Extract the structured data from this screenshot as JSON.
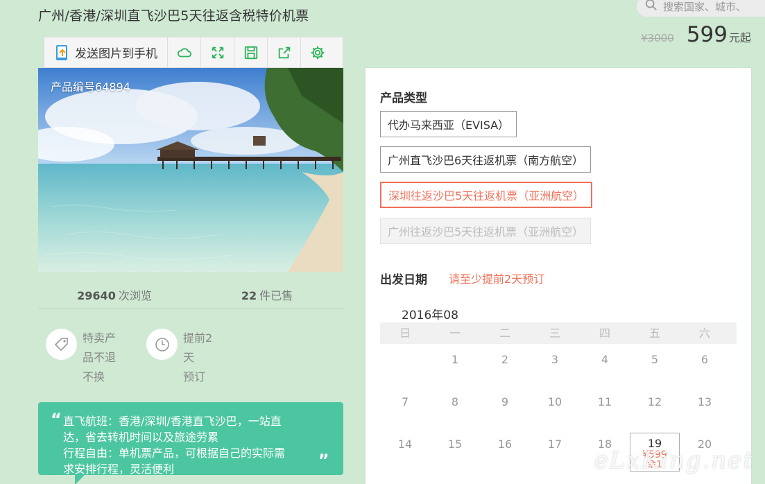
{
  "title": "广州/香港/深圳直飞沙巴5天往返含税特价机票",
  "search": {
    "placeholder": "搜索国家、城市、"
  },
  "price": {
    "old": "¥3000",
    "current": "599",
    "unit": "元起"
  },
  "toolbar": {
    "send_label": "发送图片到手机",
    "icons": [
      "send-to-phone-icon",
      "cloud-icon",
      "fullscreen-icon",
      "save-icon",
      "share-icon",
      "settings-icon"
    ]
  },
  "photo": {
    "product_no": "产品编号64894"
  },
  "stats": {
    "views_count": "29640",
    "views_label": "次浏览",
    "sold_count": "22",
    "sold_label": "件已售"
  },
  "badges": [
    {
      "icon": "tag-icon",
      "lines": [
        "特卖产",
        "品不退",
        "不换"
      ]
    },
    {
      "icon": "clock-icon",
      "lines": [
        "提前2天",
        "预订"
      ]
    }
  ],
  "quote": {
    "open": "“",
    "close": "„",
    "line1": "直飞航班：香港/深圳/香港直飞沙巴，一站直",
    "line2": "达，省去转机时间以及旅途劳累",
    "line3": "行程自由：单机票产品，可根据自己的实际需",
    "line4": "求安排行程，灵活便利"
  },
  "product_type": {
    "label": "产品类型",
    "options": [
      {
        "label": "代办马来西亚（EVISA）",
        "state": "normal"
      },
      {
        "label": "广州直飞沙巴6天往返机票（南方航空）",
        "state": "normal"
      },
      {
        "label": "深圳往返沙巴5天往返机票（亚洲航空）",
        "state": "selected"
      },
      {
        "label": "广州往返沙巴5天往返机票（亚洲航空）",
        "state": "disabled"
      }
    ]
  },
  "departure": {
    "label": "出发日期",
    "hint": "请至少提前2天预订"
  },
  "calendar": {
    "month": "2016年08",
    "weekdays": [
      "日",
      "一",
      "二",
      "三",
      "四",
      "五",
      "六"
    ],
    "rows": [
      [
        "",
        "1",
        "2",
        "3",
        "4",
        "5",
        "6"
      ],
      [
        "7",
        "8",
        "9",
        "10",
        "11",
        "12",
        "13"
      ],
      [
        "14",
        "15",
        "16",
        "17",
        "18",
        "19",
        "20"
      ]
    ],
    "available": {
      "day": "19",
      "price": "¥599",
      "remain": "余1"
    }
  },
  "colors": {
    "accent": "#f0705a",
    "background": "#cfe9d3",
    "quote_bg": "#4cc6a0",
    "icon_green": "#2cb45a"
  },
  "watermark": "eLxKing.net"
}
